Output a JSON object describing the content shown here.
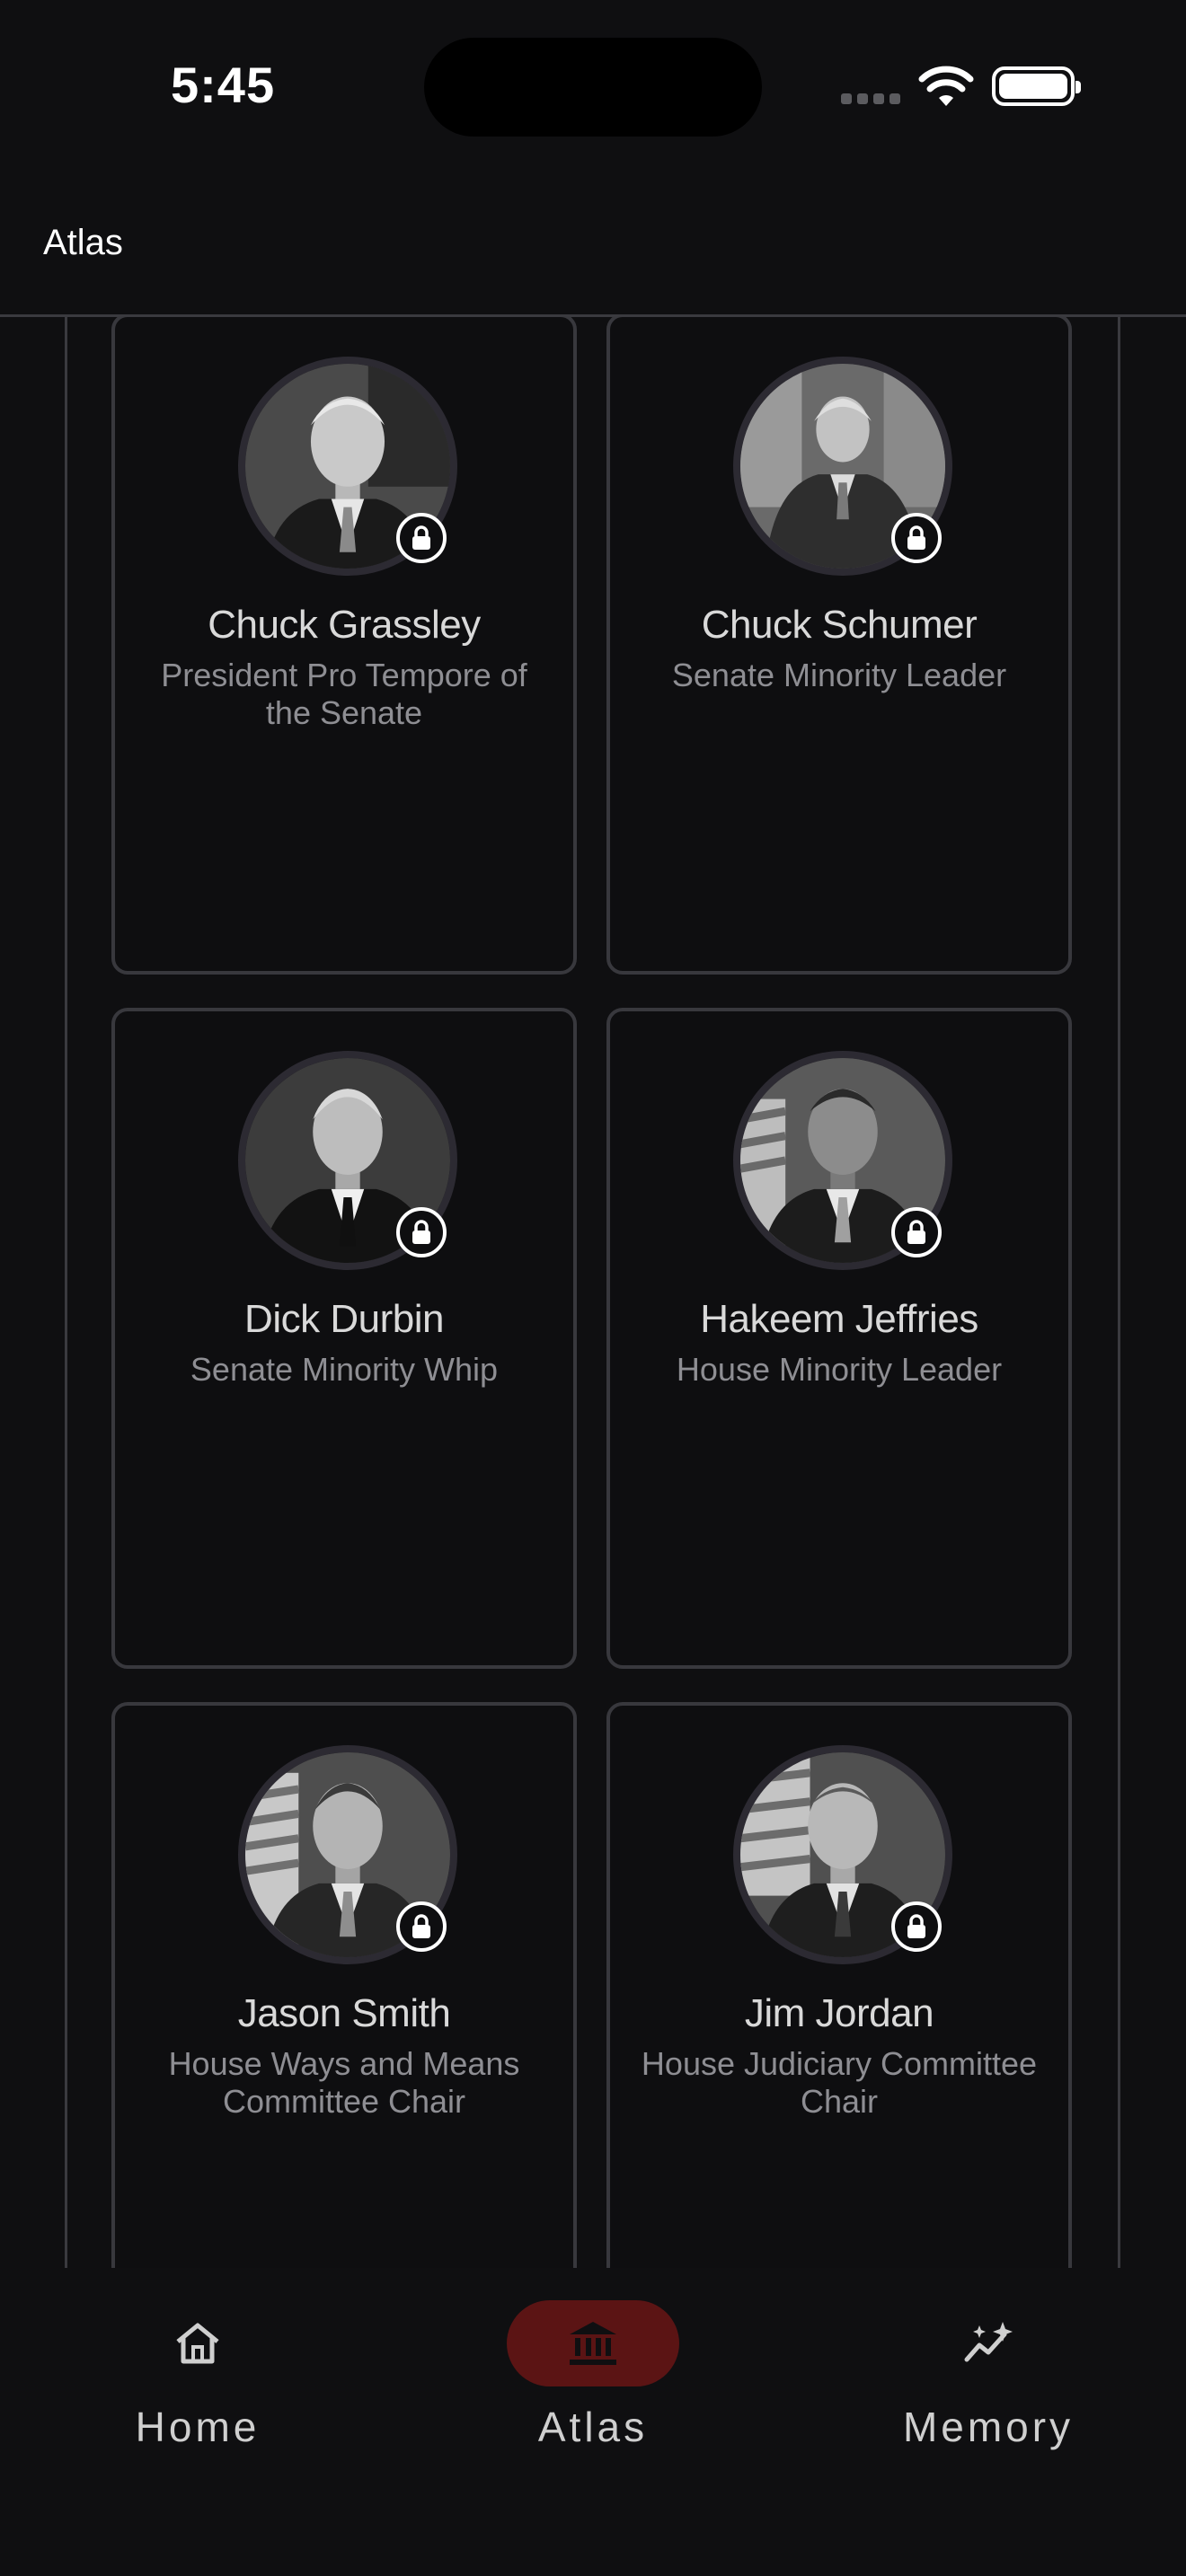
{
  "status_bar": {
    "time": "5:45"
  },
  "header": {
    "title": "Atlas"
  },
  "cards": [
    {
      "name": "Chuck Grassley",
      "role": "President Pro Tempore of the Senate"
    },
    {
      "name": "Chuck Schumer",
      "role": "Senate Minority Leader"
    },
    {
      "name": "Dick Durbin",
      "role": "Senate Minority Whip"
    },
    {
      "name": "Hakeem Jeffries",
      "role": "House Minority Leader"
    },
    {
      "name": "Jason Smith",
      "role": "House Ways and Means Committee Chair"
    },
    {
      "name": "Jim Jordan",
      "role": "House Judiciary Committee Chair"
    }
  ],
  "tabs": [
    {
      "label": "Home",
      "icon": "home-icon",
      "active": false
    },
    {
      "label": "Atlas",
      "icon": "capitol-icon",
      "active": true
    },
    {
      "label": "Memory",
      "icon": "sparkle-chart-icon",
      "active": false
    }
  ],
  "colors": {
    "background": "#0f0f11",
    "card_border": "#38383d",
    "active_tab": "#5b1414",
    "subtitle": "#8e8e93"
  }
}
